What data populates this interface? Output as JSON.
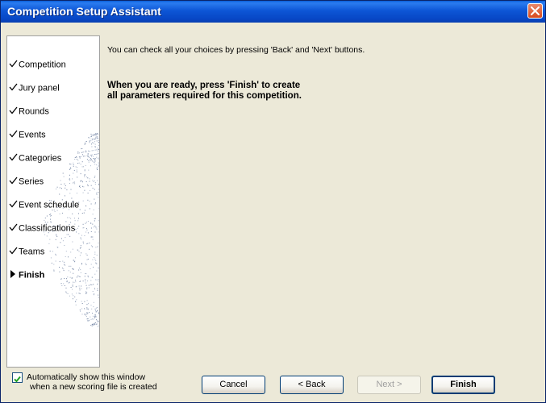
{
  "window": {
    "title": "Competition Setup Assistant"
  },
  "sidebar": {
    "items": [
      {
        "label": "Competition",
        "state": "done"
      },
      {
        "label": "Jury panel",
        "state": "done"
      },
      {
        "label": "Rounds",
        "state": "done"
      },
      {
        "label": "Events",
        "state": "done"
      },
      {
        "label": "Categories",
        "state": "done"
      },
      {
        "label": "Series",
        "state": "done"
      },
      {
        "label": "Event schedule",
        "state": "done"
      },
      {
        "label": "Classifications",
        "state": "done"
      },
      {
        "label": "Teams",
        "state": "done"
      },
      {
        "label": "Finish",
        "state": "current"
      }
    ]
  },
  "main": {
    "info": "You can check all your choices by pressing 'Back' and 'Next' buttons.",
    "ready_line1": "When you are ready, press 'Finish' to create",
    "ready_line2": "all parameters required for this competition."
  },
  "footer": {
    "auto_show_line1": "Automatically show this window",
    "auto_show_line2": "when a new scoring file is created",
    "auto_show_checked": true,
    "cancel_label": "Cancel",
    "back_label": "< Back",
    "next_label": "Next >",
    "finish_label": "Finish"
  }
}
